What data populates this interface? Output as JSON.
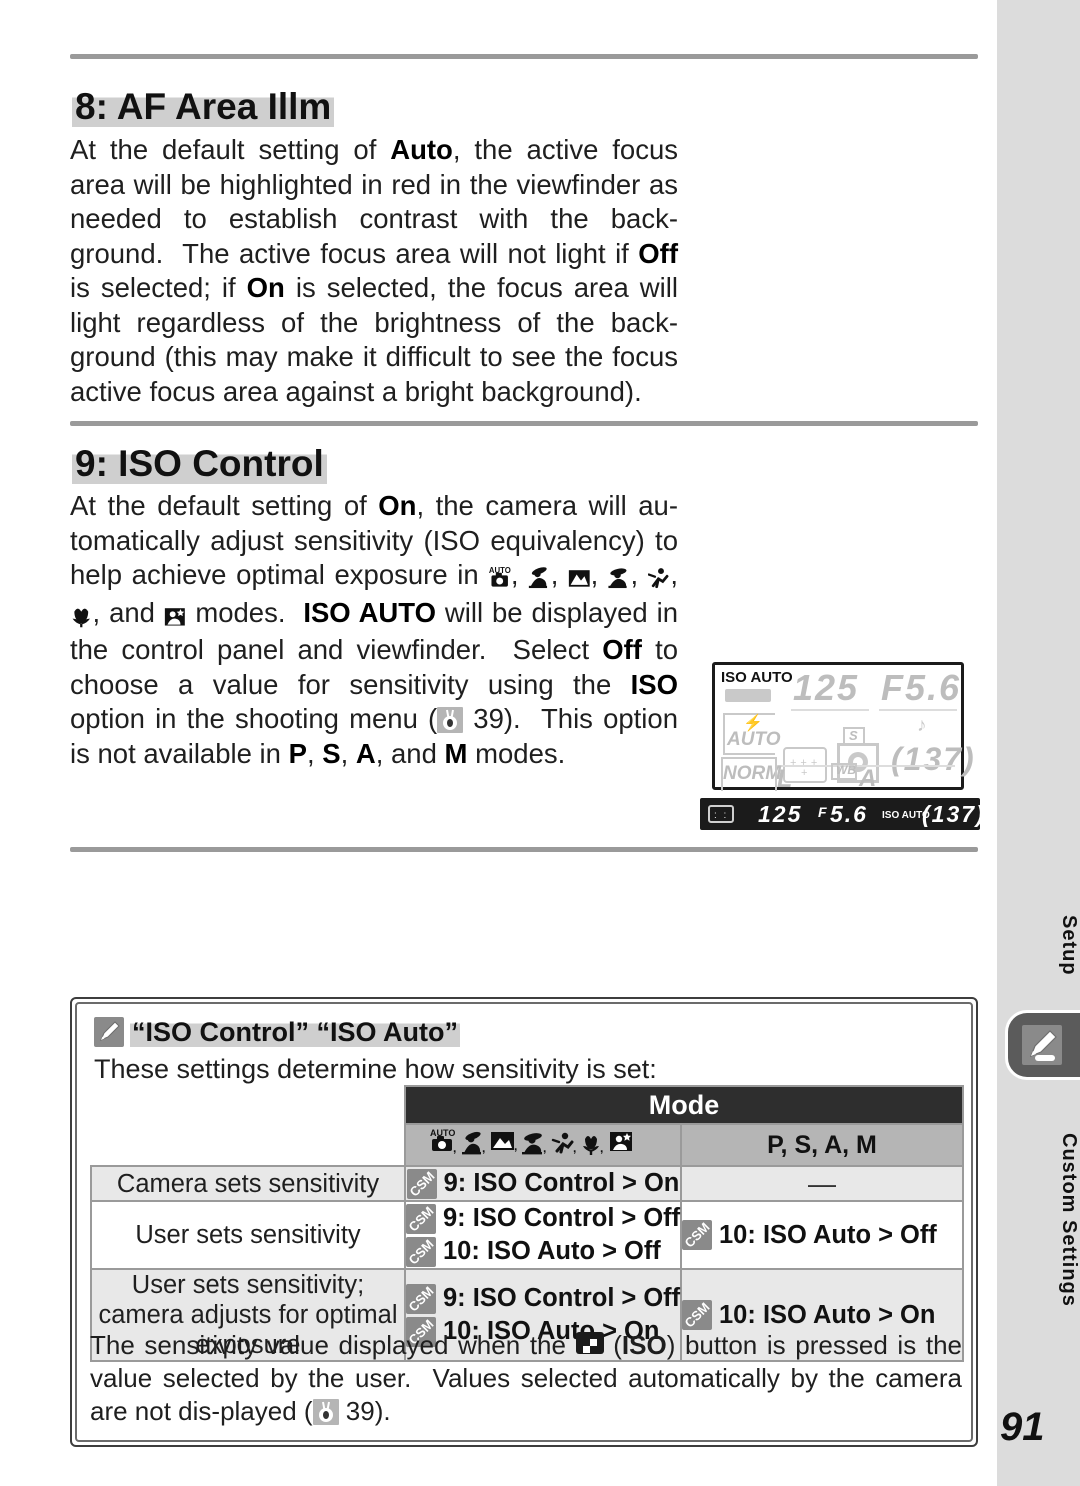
{
  "page": {
    "number": "91"
  },
  "sidebar": {
    "label_top": "Setup",
    "label_bottom": "Custom Settings",
    "tab_icon": "pencil-icon"
  },
  "sections": [
    {
      "heading": "8: AF Area Illm",
      "body_html": "At the default setting of <b>Auto</b>, the active focus area will be highlighted in red in the viewfinder as needed to establish contrast with the back-ground. &nbsp;The active focus area will not light if <b>Off</b> is selected; if <b>On</b> is selected, the focus area will light regardless of the brightness of the back-ground (this may make it difficult to see the focus active focus area against a bright background)."
    },
    {
      "heading": "9: ISO Control",
      "body_html": "At the default setting of <b>On</b>, the camera will au-tomatically adjust sensitivity (ISO equivalency) to help achieve optimal exposure in [ICON_AUTO], [ICON_PORTRAIT], [ICON_LANDSCAPE], [ICON_CHILD], [ICON_SPORT], [ICON_MACRO], and [ICON_NIGHT] modes. &nbsp;<b>ISO AUTO</b> will be displayed in the control panel and viewfinder. &nbsp;Select <b>Off</b> to choose a value for sensitivity using the <b>ISO</b> option in the shooting menu ([PGREF] 39). &nbsp;This option is not available in <b>P</b>, <b>S</b>, <b>A</b>, and <b>M</b> modes.",
      "page_reference": "39"
    }
  ],
  "control_panel": {
    "iso_auto_label": "ISO AUTO",
    "shutter_speed": "125",
    "aperture": "F5.6",
    "flash_mode": "AUTO",
    "quality": "NORM",
    "image_size": "L",
    "white_balance_label": "WB",
    "white_balance_value": "A",
    "release_mode": "S",
    "frames_remaining": "137"
  },
  "viewfinder": {
    "shutter_speed": "125",
    "aperture_prefix": "F",
    "aperture": "5.6",
    "iso_auto_label": "ISO AUTO",
    "frames_remaining": "137"
  },
  "note": {
    "icon": "pencil-icon",
    "title": "“ISO Control” “ISO Auto”",
    "subtitle": "These settings determine how sensitivity is set:",
    "footer_html": "The sensitivity value displayed when the [ISOBTN] (<b>ISO</b>) button is pressed is the value selected by the user. &nbsp;Values selected automatically by the camera are not dis-played ([PGREF] 39).",
    "footer_page_reference": "39"
  },
  "table": {
    "group_header": "Mode",
    "col_scene_icons": [
      "auto-mode-icon",
      "portrait-mode-icon",
      "landscape-mode-icon",
      "child-mode-icon",
      "sports-mode-icon",
      "close-up-mode-icon",
      "night-portrait-mode-icon"
    ],
    "col_psam": "P, S, A, M",
    "rows": [
      {
        "description": "Camera sets sensitivity",
        "scene_options": [
          {
            "badge": "CSM",
            "text": "9: ISO Control",
            "arrow": ">",
            "value": "On"
          }
        ],
        "psam_options": [],
        "psam_dash": "—"
      },
      {
        "description": "User sets sensitivity",
        "scene_options": [
          {
            "badge": "CSM",
            "text": "9: ISO Control",
            "arrow": ">",
            "value": "Off"
          },
          {
            "badge": "CSM",
            "text": "10: ISO Auto",
            "arrow": ">",
            "value": "Off"
          }
        ],
        "psam_options": [
          {
            "badge": "CSM",
            "text": "10: ISO Auto",
            "arrow": ">",
            "value": "Off"
          }
        ],
        "psam_dash": ""
      },
      {
        "description": "User sets sensitivity; camera adjusts for optimal exposure",
        "scene_options": [
          {
            "badge": "CSM",
            "text": "9: ISO Control",
            "arrow": ">",
            "value": "Off"
          },
          {
            "badge": "CSM",
            "text": "10: ISO Auto",
            "arrow": ">",
            "value": "On"
          }
        ],
        "psam_options": [
          {
            "badge": "CSM",
            "text": "10: ISO Auto",
            "arrow": ">",
            "value": "On"
          }
        ],
        "psam_dash": ""
      }
    ]
  },
  "colors": {
    "sidebar_bg": "#dcdcdc",
    "highlight": "#cfcfcf",
    "header_dark": "#2e2e2e",
    "header_gray": "#b5b5b5",
    "row_alt": "#e8e8e8",
    "rule": "#9a9a9a"
  }
}
